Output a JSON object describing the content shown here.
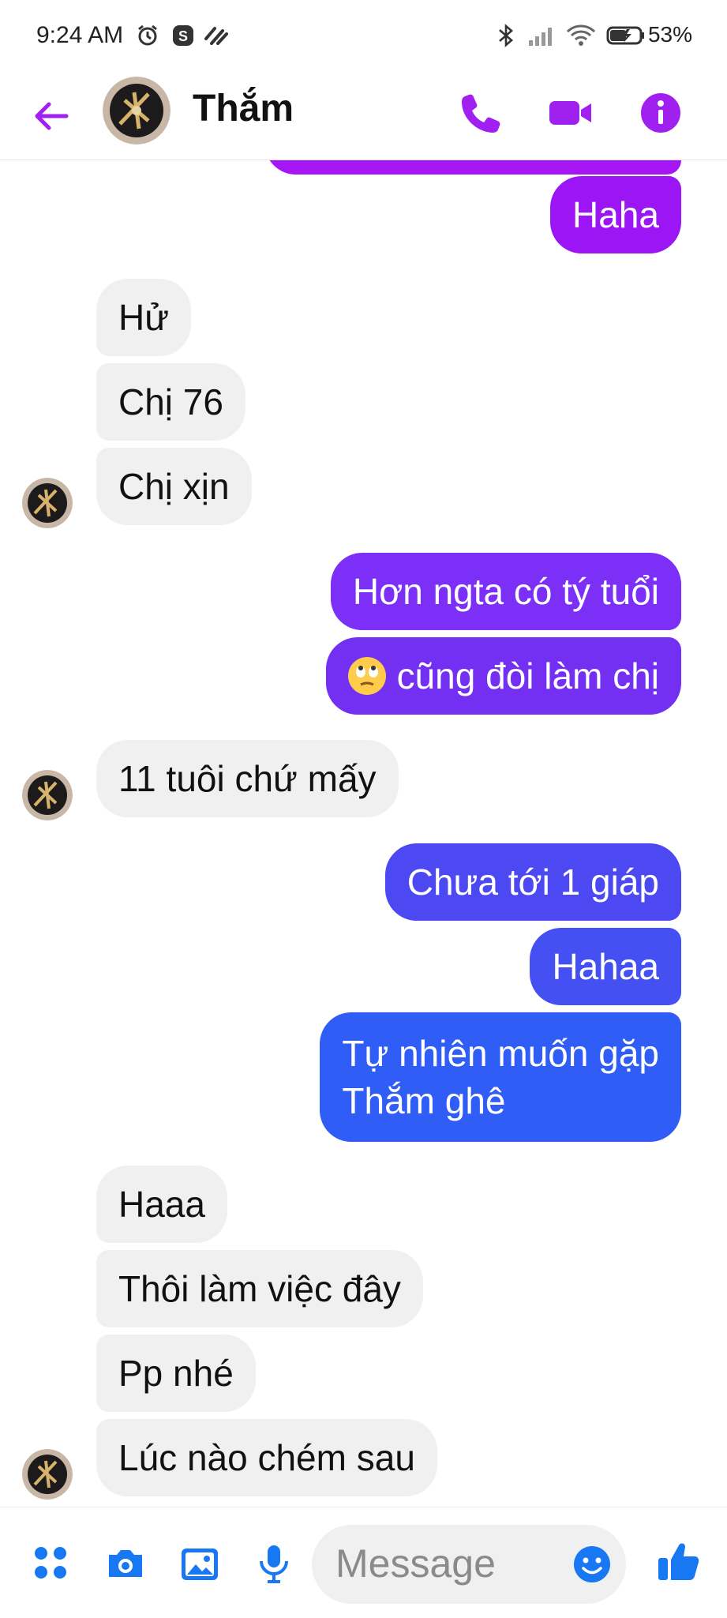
{
  "status_bar": {
    "time": "9:24 AM",
    "battery_percent": "53%",
    "icons": [
      "alarm-icon",
      "s-app-icon",
      "notification-icon",
      "bluetooth-icon",
      "signal-icon",
      "wifi-icon",
      "battery-charging-icon"
    ]
  },
  "header": {
    "contact_name": "Thắm",
    "icons": [
      "back-arrow-icon",
      "phone-icon",
      "video-call-icon",
      "info-icon"
    ],
    "accent_color": "#a020f0"
  },
  "messages": [
    {
      "from": "me",
      "text": "Haha",
      "color": "#9b15f5"
    },
    {
      "from": "them",
      "text": "Hử"
    },
    {
      "from": "them",
      "text": "Chị 76"
    },
    {
      "from": "them",
      "text": "Chị xịn"
    },
    {
      "from": "me",
      "text": "Hơn ngta có tý tuổi",
      "color": "#7b2ff7"
    },
    {
      "from": "me",
      "emoji": "rolling-eyes-emoji",
      "text": "cũng đòi làm chị",
      "color": "#7330f2"
    },
    {
      "from": "them",
      "text": "11 tuôi chứ mấy"
    },
    {
      "from": "me",
      "text": "Chưa tới 1 giáp",
      "color": "#4c48f2"
    },
    {
      "from": "me",
      "text": "Hahaa",
      "color": "#4550f3"
    },
    {
      "from": "me",
      "line1": "Tự nhiên muốn gặp",
      "line2": "Thắm ghê",
      "color": "#2f5df5"
    },
    {
      "from": "them",
      "text": "Haaa"
    },
    {
      "from": "them",
      "text": "Thôi làm việc đây"
    },
    {
      "from": "them",
      "text": "Pp nhé"
    },
    {
      "from": "them",
      "text": "Lúc nào chém sau"
    }
  ],
  "composer": {
    "placeholder": "Message",
    "icons": [
      "apps-icon",
      "camera-icon",
      "gallery-icon",
      "microphone-icon",
      "emoji-icon",
      "thumbs-up-icon"
    ],
    "icon_color": "#1877f2"
  }
}
